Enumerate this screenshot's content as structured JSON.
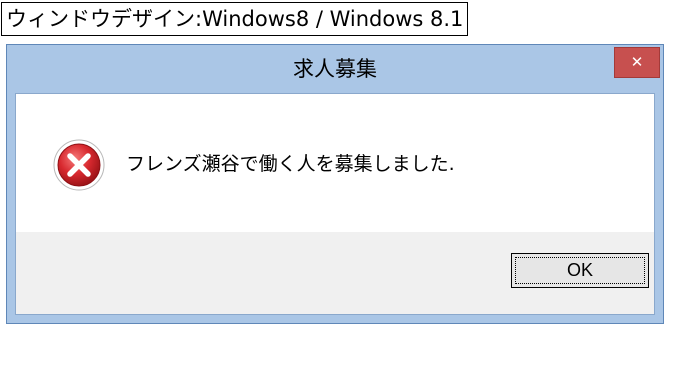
{
  "caption": "ウィンドウデザイン:Windows8 / Windows 8.1",
  "dialog": {
    "title": "求人募集",
    "message": "フレンズ瀬谷で働く人を募集しました.",
    "ok_label": "OK",
    "close_glyph": "✕"
  },
  "icons": {
    "error": "error-x-icon",
    "close": "close-icon"
  },
  "colors": {
    "frame": "#aac6e6",
    "close_button": "#c7504f",
    "error_icon": "#d8292f",
    "footer": "#f0f0f0"
  }
}
